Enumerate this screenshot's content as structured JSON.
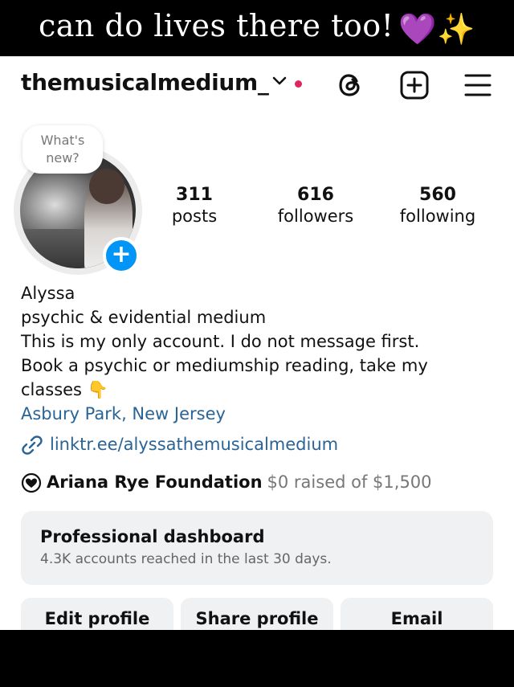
{
  "caption": {
    "text": "can do lives there too!",
    "emoji": "💜✨"
  },
  "profile": {
    "username": "themusicalmedium_",
    "bubble_text": "What's new?",
    "stats": [
      {
        "value": "311",
        "label": "posts"
      },
      {
        "value": "616",
        "label": "followers"
      },
      {
        "value": "560",
        "label": "following"
      }
    ],
    "name": "Alyssa",
    "bio_lines": [
      "psychic & evidential medium",
      "This is my only account. I do not message first.",
      "Book a psychic or mediumship reading, take my",
      "classes 👇"
    ],
    "location": "Asbury Park, New Jersey",
    "link": "linktr.ee/alyssathemusicalmedium",
    "fundraiser": {
      "name": "Ariana Rye Foundation",
      "status": "$0 raised of $1,500"
    }
  },
  "dashboard": {
    "title": "Professional dashboard",
    "subtitle": "4.3K accounts reached in the last 30 days."
  },
  "buttons": {
    "edit": "Edit profile",
    "share": "Share profile",
    "email": "Email"
  },
  "colors": {
    "accent": "#0095f6",
    "link": "#2a6496",
    "notification": "#e0245e"
  }
}
